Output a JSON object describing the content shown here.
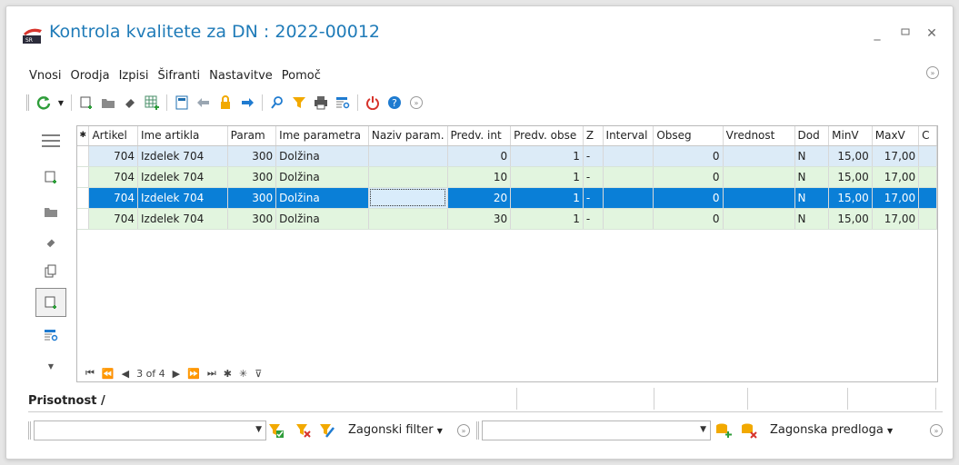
{
  "window": {
    "title": "Kontrola kvalitete za DN : 2022-00012"
  },
  "menu": [
    "Vnosi",
    "Orodja",
    "Izpisi",
    "Šifranti",
    "Nastavitve",
    "Pomoč"
  ],
  "grid": {
    "columns": [
      "Artikel",
      "Ime artikla",
      "Param",
      "Ime parametra",
      "Naziv param.",
      "Predv. int",
      "Predv. obse",
      "Z",
      "Interval",
      "Obseg",
      "Vrednost",
      "Dod",
      "MinV",
      "MaxV",
      "C"
    ],
    "rows": [
      [
        "704",
        "Izdelek 704",
        "300",
        "Dolžina",
        "",
        "0",
        "1",
        "-",
        "",
        "0",
        "",
        "N",
        "15,00",
        "17,00",
        ""
      ],
      [
        "704",
        "Izdelek 704",
        "300",
        "Dolžina",
        "",
        "10",
        "1",
        "-",
        "",
        "0",
        "",
        "N",
        "15,00",
        "17,00",
        ""
      ],
      [
        "704",
        "Izdelek 704",
        "300",
        "Dolžina",
        "",
        "20",
        "1",
        "-",
        "",
        "0",
        "",
        "N",
        "15,00",
        "17,00",
        ""
      ],
      [
        "704",
        "Izdelek 704",
        "300",
        "Dolžina",
        "",
        "30",
        "1",
        "-",
        "",
        "0",
        "",
        "N",
        "15,00",
        "17,00",
        ""
      ]
    ],
    "selected_row": 2,
    "navigator": "3 of 4"
  },
  "presence": {
    "label": "Prisotnost /"
  },
  "filter": {
    "value": "",
    "default_filter_label": "Zagonski filter",
    "template_value": "",
    "default_template_label": "Zagonska predloga"
  },
  "colors": {
    "accent": "#1f7bb8",
    "selected": "#0a7fd7",
    "row_blue": "#dcebf7",
    "row_green": "#e2f5df"
  }
}
